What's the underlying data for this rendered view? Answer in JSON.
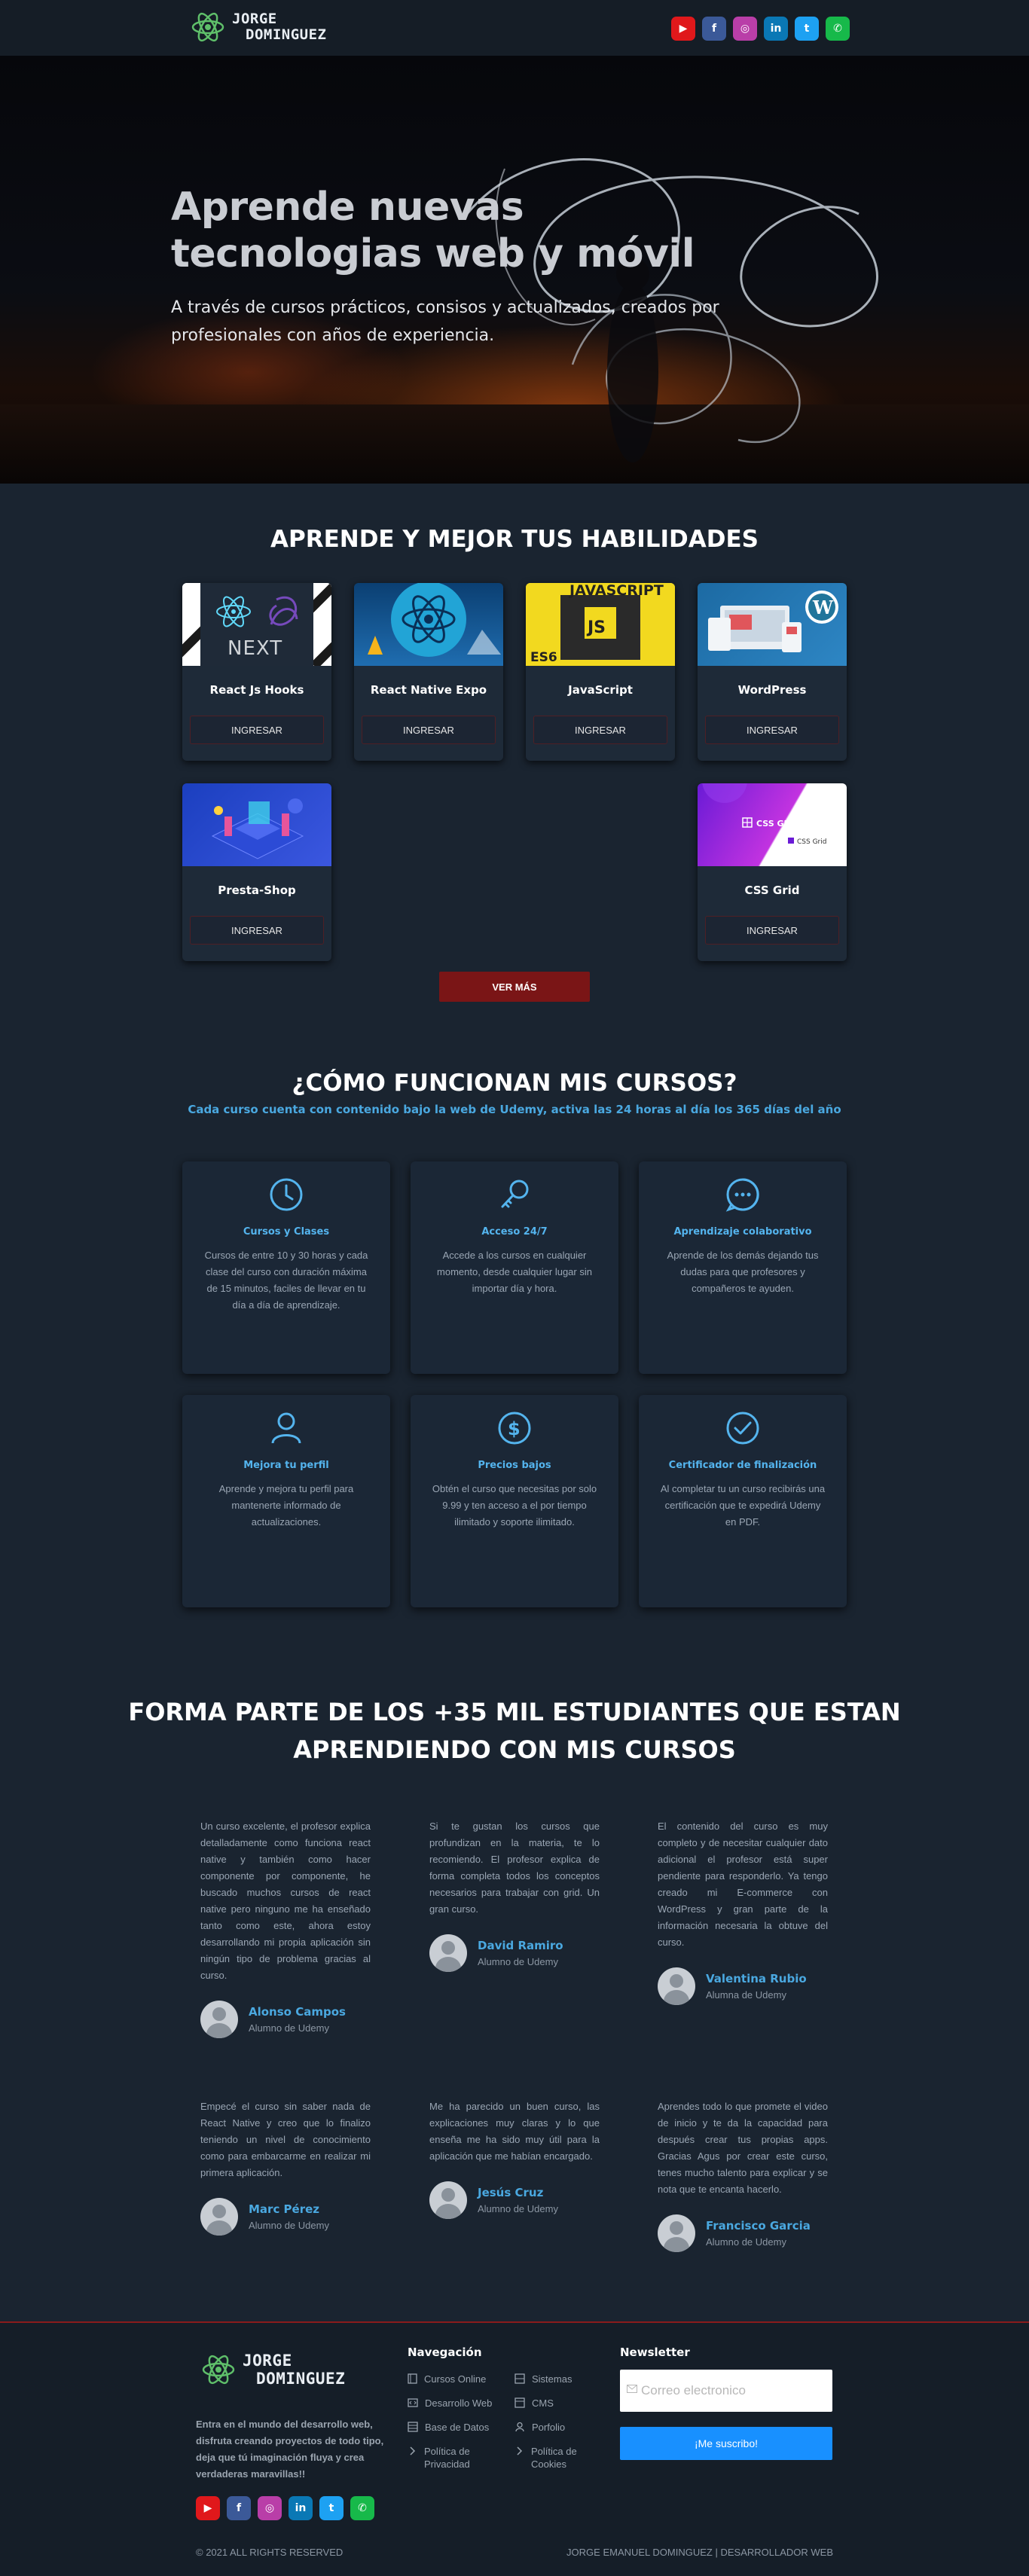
{
  "header": {
    "logo_line1": "JORGE",
    "logo_line2": "DOMINGUEZ",
    "socials": [
      {
        "name": "youtube-icon",
        "glyph": "▶",
        "color": "#e0181b"
      },
      {
        "name": "facebook-icon",
        "glyph": "f",
        "color": "#3b5998"
      },
      {
        "name": "instagram-icon",
        "glyph": "◎",
        "color": "#b93ea8"
      },
      {
        "name": "linkedin-icon",
        "glyph": "in",
        "color": "#0a78b5"
      },
      {
        "name": "twitter-icon",
        "glyph": "t",
        "color": "#1da1f2"
      },
      {
        "name": "whatsapp-icon",
        "glyph": "✆",
        "color": "#17b94a"
      }
    ]
  },
  "hero": {
    "title_line1": "Aprende nuevas",
    "title_line2": "tecnologias web y móvil",
    "subtitle_line1": "A través de cursos prácticos, consisos y actualizados, creados por",
    "subtitle_line2": "profesionales con años de experiencia."
  },
  "skills": {
    "title": "APRENDE Y MEJOR TUS HABILIDADES",
    "button_label": "INGRESAR",
    "courses": [
      {
        "name": "React Js Hooks",
        "image": "react-next-logos"
      },
      {
        "name": "React Native Expo",
        "image": "react-native-logo"
      },
      {
        "name": "JavaScript",
        "image": "javascript-es6-logo",
        "image_text": "JAVASCRIPT",
        "image_badge": "JS",
        "image_corner": "ES6"
      },
      {
        "name": "WordPress",
        "image": "wordpress-devices"
      },
      {
        "name": "Presta-Shop",
        "image": "prestashop-isometric"
      },
      {
        "name": "CSS Grid",
        "image": "css-grid-gradient",
        "image_text": "CSS GRID",
        "image_badge": "CSS Grid"
      }
    ],
    "more_label": "VER MÁS"
  },
  "how": {
    "title": "¿CÓMO FUNCIONAN MIS CURSOS?",
    "subtitle": "Cada curso cuenta con contenido bajo la web de Udemy, activa las 24 horas al día los 365 días del año",
    "features": [
      {
        "icon": "clock-icon",
        "title": "Cursos y Clases",
        "text": "Cursos de entre 10 y 30 horas y cada clase del curso con duración máxima de 15 minutos, faciles de llevar en tu día a día de aprendizaje."
      },
      {
        "icon": "key-icon",
        "title": "Acceso 24/7",
        "text": "Accede a los cursos en cualquier momento, desde cualquier lugar sin importar día y hora."
      },
      {
        "icon": "chat-icon",
        "title": "Aprendizaje colaborativo",
        "text": "Aprende de los demás dejando tus dudas para que profesores y compañeros te ayuden."
      },
      {
        "icon": "user-icon",
        "title": "Mejora tu perfil",
        "text": "Aprende y mejora tu perfil para mantenerte informado de actualizaciones."
      },
      {
        "icon": "dollar-icon",
        "title": "Precios bajos",
        "text": "Obtén el curso que necesitas por solo 9.99 y ten acceso a el por tiempo ilimitado y soporte ilimitado."
      },
      {
        "icon": "check-circle-icon",
        "title": "Certificador de finalización",
        "text": "Al completar tu un curso recibirás una certificación que te expedirá Udemy en PDF."
      }
    ]
  },
  "testimonials": {
    "title_line1": "FORMA PARTE DE LOS +35 MIL ESTUDIANTES QUE ESTAN",
    "title_line2": "APRENDIENDO CON MIS CURSOS",
    "items": [
      {
        "text": "Un curso excelente, el profesor explica detalladamente como funciona react native y también como hacer componente por componente, he buscado muchos cursos de react native pero ninguno me ha enseñado tanto como este, ahora estoy desarrollando mi propia aplicación sin ningún tipo de problema gracias al curso.",
        "name": "Alonso Campos",
        "role": "Alumno de Udemy"
      },
      {
        "text": "Si te gustan los cursos que profundizan en la materia, te lo recomiendo. El profesor explica de forma completa todos los conceptos necesarios para trabajar con grid. Un gran curso.",
        "name": "David Ramiro",
        "role": "Alumno de Udemy"
      },
      {
        "text": "El contenido del curso es muy completo y de necesitar cualquier dato adicional el profesor está super pendiente para responderlo. Ya tengo creado mi E-commerce con WordPress y gran parte de la información necesaria la obtuve del curso.",
        "name": "Valentina Rubio",
        "role": "Alumna de Udemy"
      },
      {
        "text": "Empecé el curso sin saber nada de React Native y creo que lo finalizo teniendo un nivel de conocimiento como para embarcarme en realizar mi primera aplicación.",
        "name": "Marc Pérez",
        "role": "Alumno de Udemy"
      },
      {
        "text": "Me ha parecido un buen curso, las explicaciones muy claras y lo que enseña me ha sido muy útil para la aplicación que me habían encargado.",
        "name": "Jesús Cruz",
        "role": "Alumno de Udemy"
      },
      {
        "text": "Aprendes todo lo que promete el video de inicio y te da la capacidad para después crear tus propias apps. Gracias Agus por crear este curso, tenes mucho talento para explicar y se nota que te encanta hacerlo.",
        "name": "Francisco Garcia",
        "role": "Alumno de Udemy"
      }
    ]
  },
  "footer": {
    "logo_line1": "JORGE",
    "logo_line2": "DOMINGUEZ",
    "description": "Entra en el mundo del desarrollo web, disfruta creando proyectos de todo tipo, deja que tú imaginación fluya y crea verdaderas maravillas!!",
    "nav_title": "Navegación",
    "nav_col1": [
      "Cursos Online",
      "Desarrollo Web",
      "Base de Datos",
      "Política de Privacidad"
    ],
    "nav_col2": [
      "Sistemas",
      "CMS",
      "Porfolio",
      "Política de Cookies"
    ],
    "newsletter_title": "Newsletter",
    "newsletter_placeholder": "Correo electronico",
    "newsletter_button": "¡Me suscribo!",
    "copyright": "© 2021 ALL RIGHTS RESERVED",
    "credit": "JORGE EMANUEL DOMINGUEZ | DESARROLLADOR WEB"
  }
}
